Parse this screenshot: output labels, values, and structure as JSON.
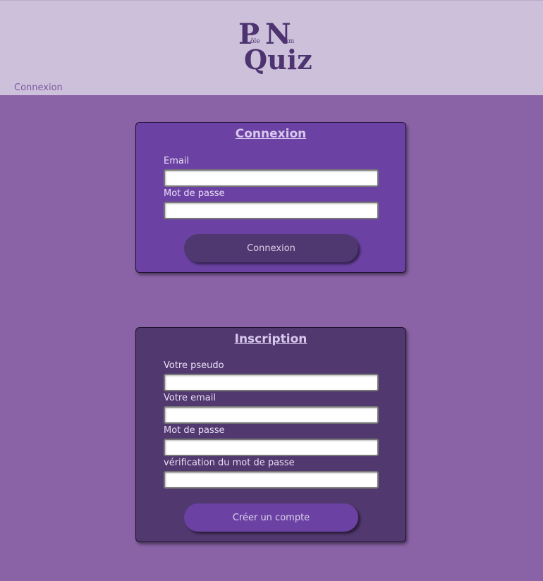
{
  "header": {
    "logo": {
      "p_big": "P",
      "p_small": "ôle",
      "n_big": "N",
      "n_small": "um",
      "quiz": "Quiz"
    },
    "nav_link": "Connexion"
  },
  "login": {
    "title": "Connexion",
    "email_label": "Email",
    "email_value": "",
    "password_label": "Mot de passe",
    "password_value": "",
    "submit_label": "Connexion"
  },
  "signup": {
    "title": "Inscription",
    "pseudo_label": "Votre pseudo",
    "pseudo_value": "",
    "email_label": "Votre email",
    "email_value": "",
    "password_label": "Mot de passe",
    "password_value": "",
    "password_confirm_label": "vérification du mot de passe",
    "password_confirm_value": "",
    "submit_label": "Créer un compte"
  },
  "colors": {
    "page_background": "#8a63a6",
    "header_background": "#cdc0da",
    "login_card": "#6b42a3",
    "signup_card": "#51386f",
    "logo": "#4d3470"
  }
}
